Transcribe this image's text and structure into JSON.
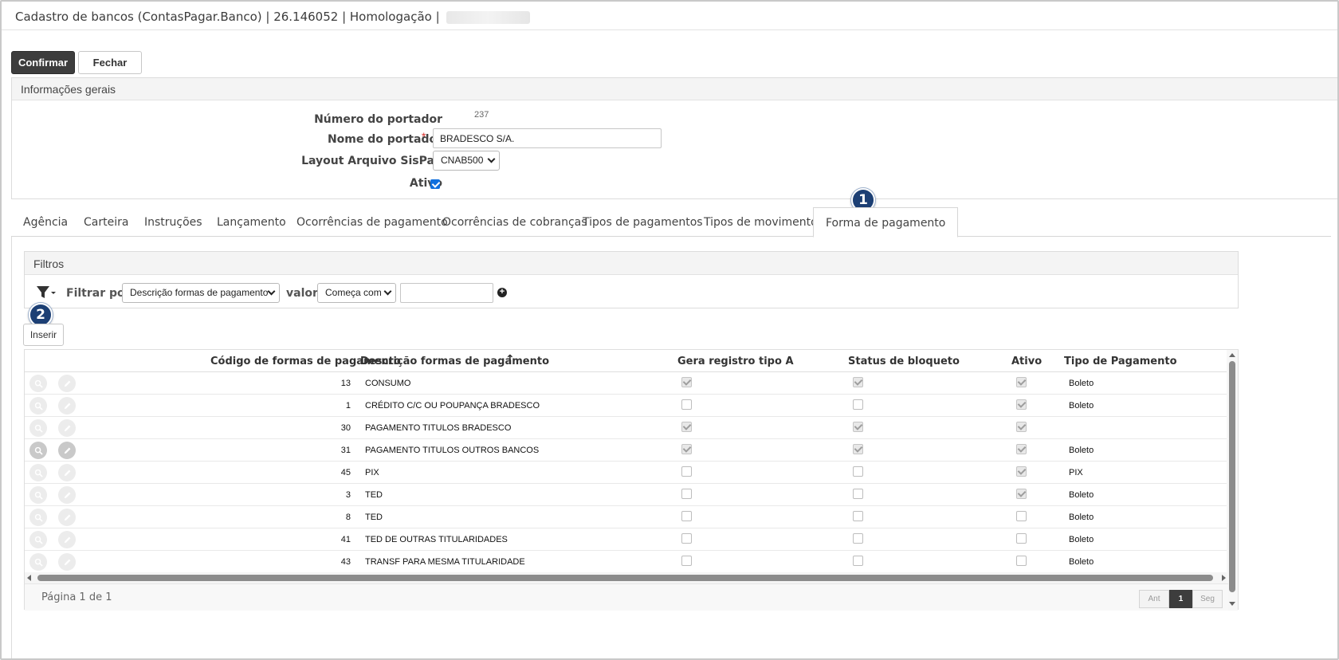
{
  "window": {
    "title": "Cadastro de bancos (ContasPagar.Banco) | 26.146052 | Homologação |"
  },
  "toolbar": {
    "confirm_label": "Confirmar",
    "close_label": "Fechar"
  },
  "general": {
    "header": "Informações gerais",
    "fields": {
      "numero_label": "Número do portador",
      "numero_value": "237",
      "nome_label": "Nome do portador",
      "nome_value": "BRADESCO S/A.",
      "required_mark": "*",
      "layout_label": "Layout Arquivo SisPag",
      "layout_value": "CNAB500",
      "ativo_label": "Ativo",
      "ativo_checked": true
    }
  },
  "tabs": [
    {
      "label": "Agência"
    },
    {
      "label": "Carteira"
    },
    {
      "label": "Instruções"
    },
    {
      "label": "Lançamento"
    },
    {
      "label": "Ocorrências de pagamento"
    },
    {
      "label": "Ocorrências de cobranças"
    },
    {
      "label": "Tipos de pagamentos"
    },
    {
      "label": "Tipos de movimentos"
    },
    {
      "label": "Forma de pagamento"
    }
  ],
  "active_tab": "Forma de pagamento",
  "callouts": {
    "one": "1",
    "two": "2"
  },
  "filters": {
    "header": "Filtros",
    "filter_by_label": "Filtrar por",
    "filter_field_value": "Descrição formas de pagamento",
    "value_label": "valor",
    "operator_value": "Começa com",
    "text_value": ""
  },
  "insert_label": "Inserir",
  "table": {
    "columns": {
      "codigo": "Código de formas de pagamento",
      "descricao": "Descrição formas de pagamento",
      "sort_indicator": "↑",
      "gera": "Gera registro tipo A",
      "status": "Status de bloqueto",
      "ativo": "Ativo",
      "tipo": "Tipo de Pagamento"
    },
    "rows": [
      {
        "codigo": "13",
        "descricao": "CONSUMO",
        "gera": true,
        "status": true,
        "ativo": true,
        "tipo": "Boleto"
      },
      {
        "codigo": "1",
        "descricao": "CRÉDITO C/C OU POUPANÇA BRADESCO",
        "gera": false,
        "status": false,
        "ativo": true,
        "tipo": "Boleto"
      },
      {
        "codigo": "30",
        "descricao": "PAGAMENTO TITULOS BRADESCO",
        "gera": true,
        "status": true,
        "ativo": true,
        "tipo": ""
      },
      {
        "codigo": "31",
        "descricao": "PAGAMENTO TITULOS OUTROS BANCOS",
        "gera": true,
        "status": true,
        "ativo": true,
        "tipo": "Boleto"
      },
      {
        "codigo": "45",
        "descricao": "PIX",
        "gera": false,
        "status": false,
        "ativo": true,
        "tipo": "PIX"
      },
      {
        "codigo": "3",
        "descricao": "TED",
        "gera": false,
        "status": false,
        "ativo": true,
        "tipo": "Boleto"
      },
      {
        "codigo": "8",
        "descricao": "TED",
        "gera": false,
        "status": false,
        "ativo": false,
        "tipo": "Boleto"
      },
      {
        "codigo": "41",
        "descricao": "TED DE OUTRAS TITULARIDADES",
        "gera": false,
        "status": false,
        "ativo": false,
        "tipo": "Boleto"
      },
      {
        "codigo": "43",
        "descricao": "TRANSF PARA MESMA TITULARIDADE",
        "gera": false,
        "status": false,
        "ativo": false,
        "tipo": "Boleto"
      }
    ]
  },
  "pager": {
    "info": "Página 1 de 1",
    "prev": "Ant",
    "current": "1",
    "next": "Seg"
  }
}
